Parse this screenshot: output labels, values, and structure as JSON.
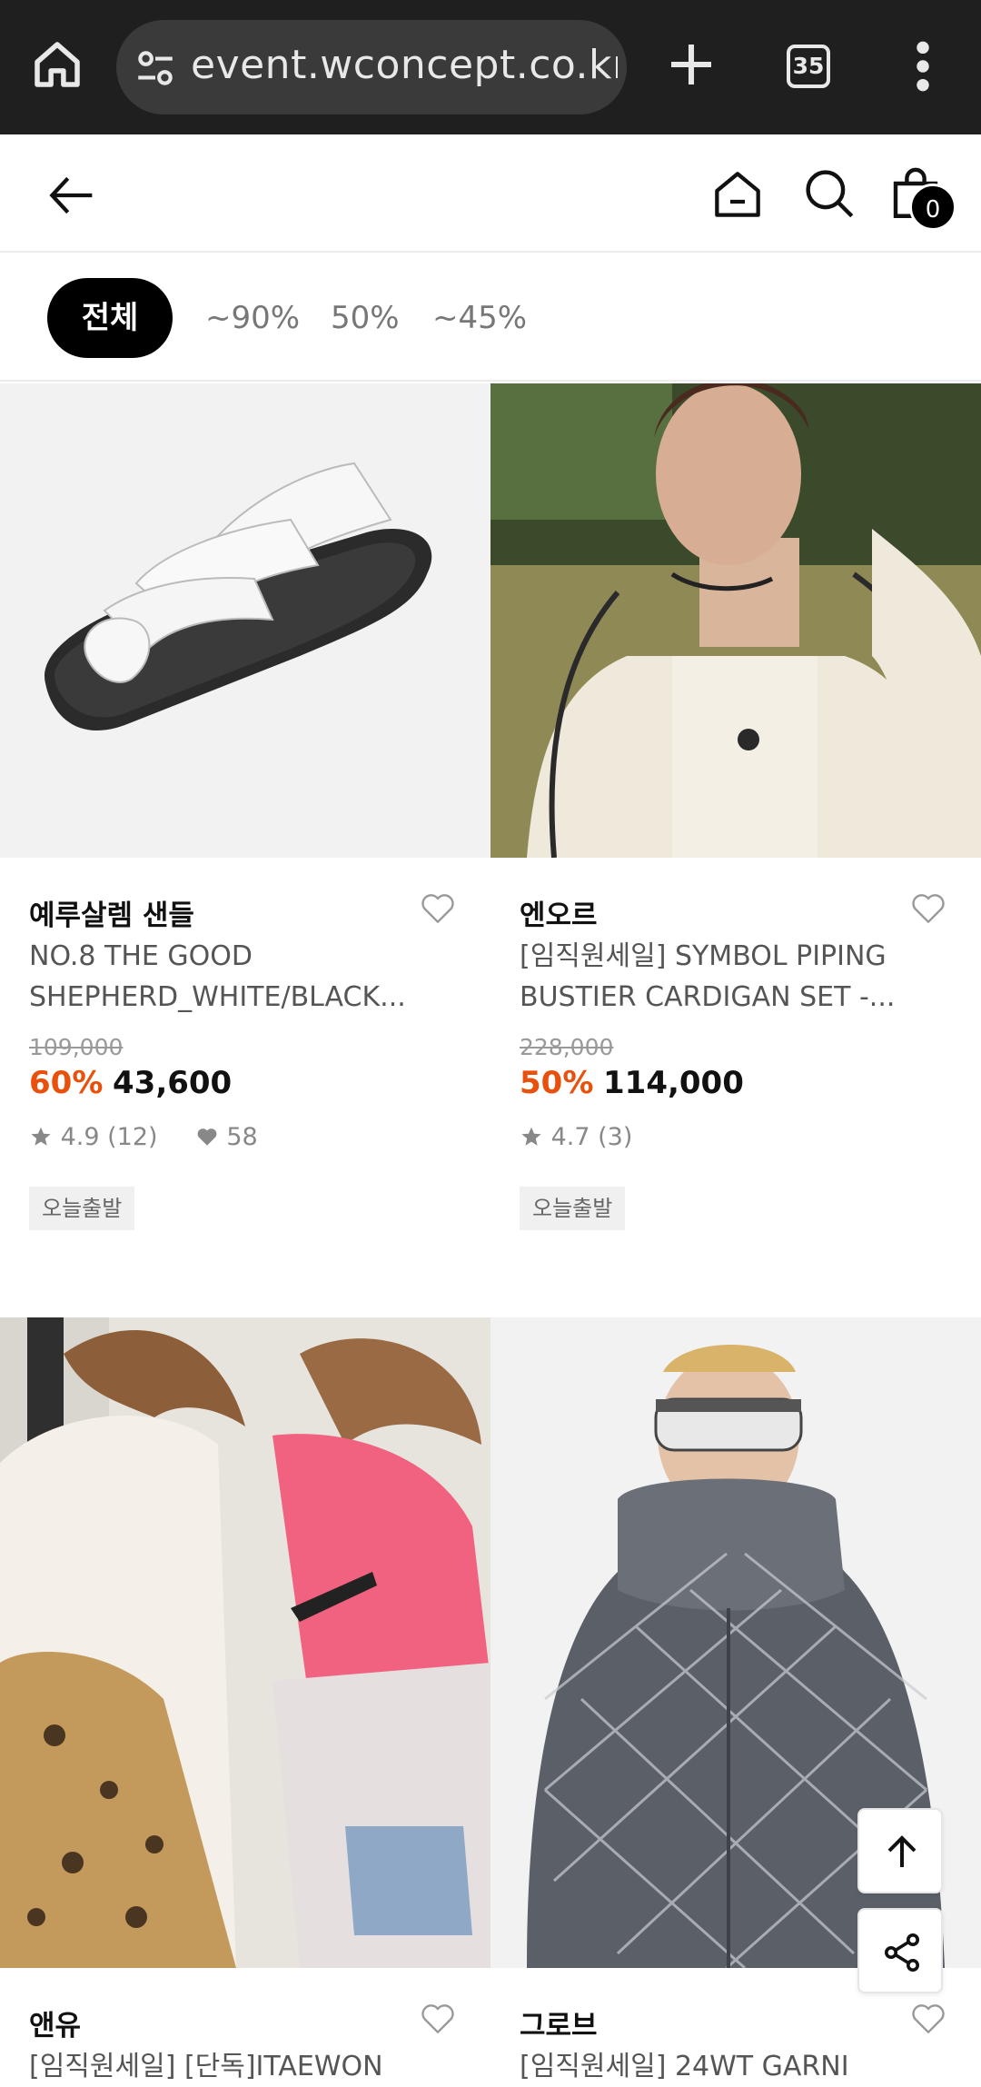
{
  "browser": {
    "url": "event.wconcept.co.kr",
    "tab_count": "35"
  },
  "header": {
    "cart_count": "0"
  },
  "filters": {
    "active": "전체",
    "options": [
      "~90%",
      "50%",
      "~45%"
    ]
  },
  "products": [
    {
      "brand": "예루살렘 샌들",
      "name": "NO.8 THE GOOD SHEPHERD_WHITE/BLACK...",
      "original_price": "109,000",
      "discount": "60%",
      "price": "43,600",
      "rating": "4.9 (12)",
      "likes": "58",
      "tag": "오늘출발"
    },
    {
      "brand": "엔오르",
      "name": "[임직원세일] SYMBOL PIPING BUSTIER CARDIGAN SET -...",
      "original_price": "228,000",
      "discount": "50%",
      "price": "114,000",
      "rating": "4.7 (3)",
      "tag": "오늘출발"
    },
    {
      "brand": "앤유",
      "name": "[임직원세일] [단독]ITAEWON"
    },
    {
      "brand": "그로브",
      "name": "[임직원세일] 24WT GARNI"
    }
  ],
  "colors": {
    "discount": "#e8500b",
    "chrome_bg": "#1f1f1f"
  }
}
